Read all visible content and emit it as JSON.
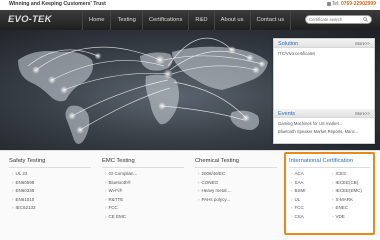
{
  "header": {
    "tagline": "Winning and Keeping Customers' Trust",
    "phone_label": "Tel:",
    "phone": "0769-22902999"
  },
  "nav": {
    "logo": "EVO-TEK",
    "items": [
      "Home",
      "Testing",
      "Certifications",
      "R&D",
      "About us",
      "Contact us"
    ],
    "search_placeholder": "Certificate search",
    "search_icon": "search-icon"
  },
  "solution": {
    "title": "Solution",
    "more": "More>>",
    "items": [
      "ITC/Vivo certificates"
    ]
  },
  "events": {
    "title": "Events",
    "more": "More>>",
    "items": [
      "Gaming Machines for US market...",
      "Bluetooth Speaker Market Reports, Manc..."
    ]
  },
  "columns": [
    {
      "title": "Safety Testing",
      "items": [
        "UL 22",
        "EN60598",
        "EN60335",
        "EN61010",
        "IEC62133"
      ]
    },
    {
      "title": "EMC Testing",
      "items": [
        "GI Complian...",
        "Bluetooth®",
        "Wi-Fi®",
        "R&TTE",
        "FCC",
        "CE EMC"
      ]
    },
    {
      "title": "Chemical Testing",
      "items": [
        "2008/46/EC",
        "CONEG",
        "Heavy metal ...",
        "PAHs polycy..."
      ]
    }
  ],
  "international": {
    "title": "International Certification",
    "left": [
      "ACA",
      "SAA",
      "BSMI",
      "UL",
      "FCC",
      "CSA"
    ],
    "right": [
      "ICES",
      "IECEE(CB)",
      "IECEE(EMC)",
      "S-MARK",
      "ENEC",
      "VDE"
    ]
  },
  "colors": {
    "accent_orange": "#e88a1a",
    "link_blue": "#2a6fb0",
    "nav_bg": "#2a2a2a"
  }
}
